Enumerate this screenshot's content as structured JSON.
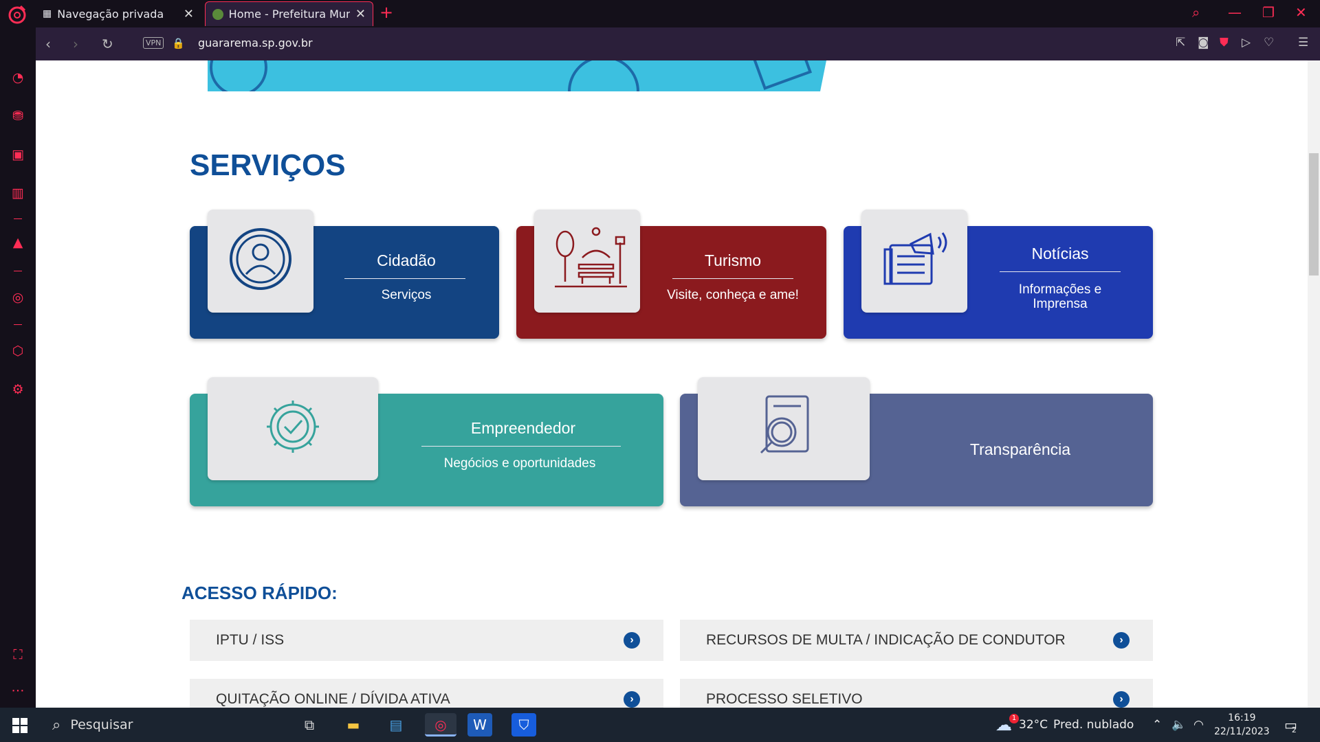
{
  "browser": {
    "tabs": [
      {
        "label": "Navegação privada"
      },
      {
        "label": "Home - Prefeitura Municip"
      }
    ],
    "url": "guararema.sp.gov.br",
    "vpn_label": "VPN"
  },
  "page": {
    "section_title": "SERVIÇOS",
    "cards": [
      {
        "title": "Cidadão",
        "subtitle": "Serviços",
        "color": "#134482",
        "icon": "person-circle-icon"
      },
      {
        "title": "Turismo",
        "subtitle": "Visite, conheça e ame!",
        "color": "#8b1a1e",
        "icon": "park-bench-icon"
      },
      {
        "title": "Notícias",
        "subtitle": "Informações e Imprensa",
        "color": "#1f3bb0",
        "icon": "newspaper-megaphone-icon"
      },
      {
        "title": "Empreendedor",
        "subtitle": "Negócios e oportunidades",
        "color": "#36a39c",
        "icon": "gear-check-icon"
      },
      {
        "title": "Transparência",
        "subtitle": "",
        "color": "#556393",
        "icon": "document-magnifier-icon"
      }
    ],
    "quick_access_title": "ACESSO RÁPIDO:",
    "quick_links": [
      {
        "label": "IPTU / ISS"
      },
      {
        "label": "RECURSOS DE MULTA / INDICAÇÃO DE CONDUTOR"
      },
      {
        "label": "QUITAÇÃO ONLINE / DÍVIDA ATIVA"
      },
      {
        "label": "PROCESSO SELETIVO"
      }
    ]
  },
  "taskbar": {
    "search_placeholder": "Pesquisar",
    "weather_temp": "32°C",
    "weather_text": "Pred. nublado",
    "weather_badge": "1",
    "time": "16:19",
    "date": "22/11/2023",
    "notification_count": "2"
  }
}
